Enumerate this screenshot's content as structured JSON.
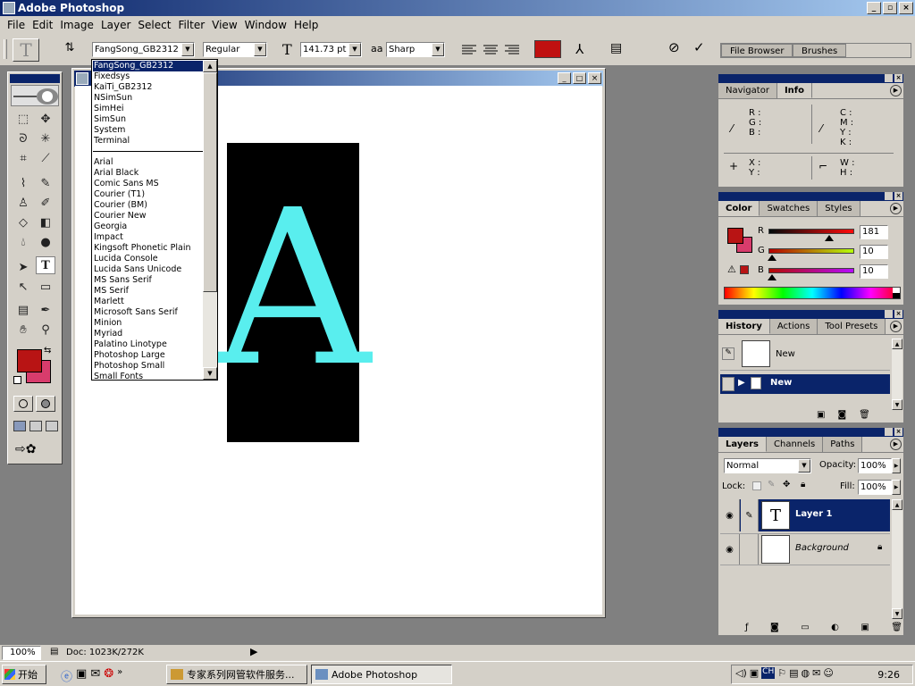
{
  "window": {
    "title": "Adobe Photoshop",
    "min": "_",
    "max": "▫",
    "close": "×"
  },
  "menu": [
    "File",
    "Edit",
    "Image",
    "Layer",
    "Select",
    "Filter",
    "View",
    "Window",
    "Help"
  ],
  "options": {
    "tool_glyph": "T",
    "font_family": "FangSong_GB2312",
    "font_style": "Regular",
    "font_size": "141.73 pt",
    "antialias_icon_label": "aa",
    "antialias": "Sharp",
    "text_color": "#c01010",
    "file_browser_tab": "File Browser",
    "brushes_tab": "Brushes"
  },
  "font_list": {
    "group1": [
      "FangSong_GB2312",
      "Fixedsys",
      "KaiTi_GB2312",
      "NSimSun",
      "SimHei",
      "SimSun",
      "System",
      "Terminal"
    ],
    "group2": [
      "Arial",
      "Arial Black",
      "Comic Sans MS",
      "Courier (T1)",
      "Courier (BM)",
      "Courier New",
      "Georgia",
      "Impact",
      "Kingsoft Phonetic Plain",
      "Lucida Console",
      "Lucida Sans Unicode",
      "MS Sans Serif",
      "MS Serif",
      "Marlett",
      "Microsoft Sans Serif",
      "Minion",
      "Myriad",
      "Palatino Linotype",
      "Photoshop Large",
      "Photoshop Small",
      "Small Fonts"
    ],
    "selected": "FangSong_GB2312"
  },
  "canvas": {
    "letter": "A",
    "letter_color": "#59eeee",
    "box_color": "#000000"
  },
  "toolbox": {
    "foreground": "#b81414",
    "background": "#d83c6c"
  },
  "info_panel": {
    "tabs": [
      "Navigator",
      "Info"
    ],
    "active_tab": "Info",
    "rgb_labels": [
      "R :",
      "G :",
      "B :"
    ],
    "cmyk_labels": [
      "C :",
      "M :",
      "Y :",
      "K :"
    ],
    "xy_labels": [
      "X :",
      "Y :"
    ],
    "wh_labels": [
      "W :",
      "H :"
    ]
  },
  "color_panel": {
    "tabs": [
      "Color",
      "Swatches",
      "Styles"
    ],
    "active_tab": "Color",
    "channels": [
      {
        "label": "R",
        "value": "181",
        "fraction": 0.71
      },
      {
        "label": "G",
        "value": "10",
        "fraction": 0.04
      },
      {
        "label": "B",
        "value": "10",
        "fraction": 0.04
      }
    ],
    "fg": "#b81414",
    "bg": "#d83c6c"
  },
  "history_panel": {
    "tabs": [
      "History",
      "Actions",
      "Tool Presets"
    ],
    "active_tab": "History",
    "snapshot_label": "New",
    "items": [
      {
        "label": "New",
        "selected": true
      }
    ]
  },
  "layers_panel": {
    "tabs": [
      "Layers",
      "Channels",
      "Paths"
    ],
    "active_tab": "Layers",
    "blend_mode": "Normal",
    "opacity_label": "Opacity:",
    "opacity": "100%",
    "lock_label": "Lock:",
    "fill_label": "Fill:",
    "fill": "100%",
    "layers": [
      {
        "name": "Layer 1",
        "thumb": "T",
        "selected": true
      },
      {
        "name": "Background",
        "thumb": "",
        "selected": false
      }
    ]
  },
  "status": {
    "zoom": "100%",
    "doc": "Doc: 1023K/272K"
  },
  "taskbar": {
    "start": "开始",
    "tasks": [
      "专家系列网管软件服务...",
      "Adobe Photoshop"
    ],
    "active_task": "Adobe Photoshop",
    "clock": "9:26",
    "tray_ime": "CH"
  }
}
